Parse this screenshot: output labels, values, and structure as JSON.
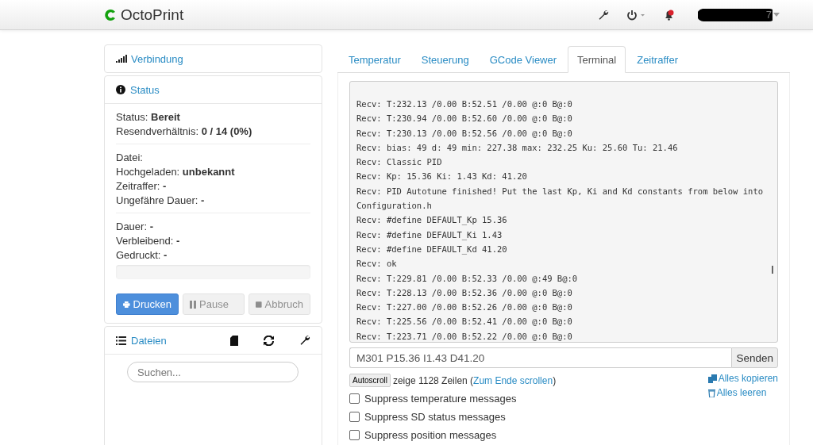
{
  "navbar": {
    "brand": "OctoPrint",
    "user_suffix": "7",
    "notification": true
  },
  "sidebar": {
    "connection": {
      "title": "Verbindung"
    },
    "status": {
      "title": "Status",
      "groups": [
        [
          "Status: **Bereit**",
          "Resendverhältnis: **0 / 14 (0%)**"
        ],
        [
          "Datei:",
          "Hochgeladen: **unbekannt**",
          "Zeitraffer: **-**",
          "Ungefähre Dauer: **-**"
        ],
        [
          "Dauer: **-**",
          "Verbleibend: **-**",
          "Gedruckt: **-**"
        ]
      ],
      "progress": {
        "level": 0
      },
      "buttons": [
        {
          "label": "Drucken",
          "kind": "print",
          "disabled": false
        },
        {
          "label": "Pause",
          "kind": "pause",
          "disabled": true
        },
        {
          "label": "Abbruch",
          "kind": "stop",
          "disabled": true
        }
      ]
    },
    "files": {
      "title": "Dateien",
      "search": {
        "placeholder": "Suchen..."
      }
    }
  },
  "tabs": [
    {
      "label": "Temperatur",
      "selected": false
    },
    {
      "label": "Steuerung",
      "selected": false
    },
    {
      "label": "GCode Viewer",
      "selected": false
    },
    {
      "label": "Terminal",
      "selected": true
    },
    {
      "label": "Zeitraffer",
      "selected": false
    }
  ],
  "terminal": {
    "lines": [
      "Recv:  T:232.13 /0.00 B:52.51 /0.00 @:0 B@:0",
      "Recv:  T:230.94 /0.00 B:52.60 /0.00 @:0 B@:0",
      "Recv:  T:230.13 /0.00 B:52.56 /0.00 @:0 B@:0",
      "Recv:  bias: 49 d: 49 min: 227.38 max: 232.25 Ku: 25.60 Tu: 21.46",
      "Recv:  Classic PID",
      "Recv:  Kp: 15.36 Ki: 1.43 Kd: 41.20",
      "Recv: PID Autotune finished! Put the last Kp, Ki and Kd constants from below into Configuration.h",
      "Recv: #define DEFAULT_Kp 15.36",
      "Recv: #define DEFAULT_Ki 1.43",
      "Recv: #define DEFAULT_Kd 41.20",
      "Recv: ok",
      "Recv:  T:229.81 /0.00 B:52.33 /0.00 @:49 B@:0",
      "Recv:  T:228.13 /0.00 B:52.36 /0.00 @:0 B@:0",
      "Recv:  T:227.00 /0.00 B:52.26 /0.00 @:0 B@:0",
      "Recv:  T:225.56 /0.00 B:52.41 /0.00 @:0 B@:0",
      "Recv:  T:223.71 /0.00 B:52.22 /0.00 @:0 B@:0"
    ],
    "command": "M301 P15.36 I1.43 D41.20",
    "send": "Senden",
    "autoscroll": "Autoscroll",
    "info_prefix": "zeige 1128 Zeilen (",
    "info_link": "Zum Ende scrollen",
    "info_suffix": ")",
    "copy": "Alles kopieren",
    "clear": "Alles leeren",
    "options": [
      {
        "label": "Suppress temperature messages",
        "checked": false
      },
      {
        "label": "Suppress SD status messages",
        "checked": false
      },
      {
        "label": "Suppress position messages",
        "checked": false
      }
    ]
  }
}
